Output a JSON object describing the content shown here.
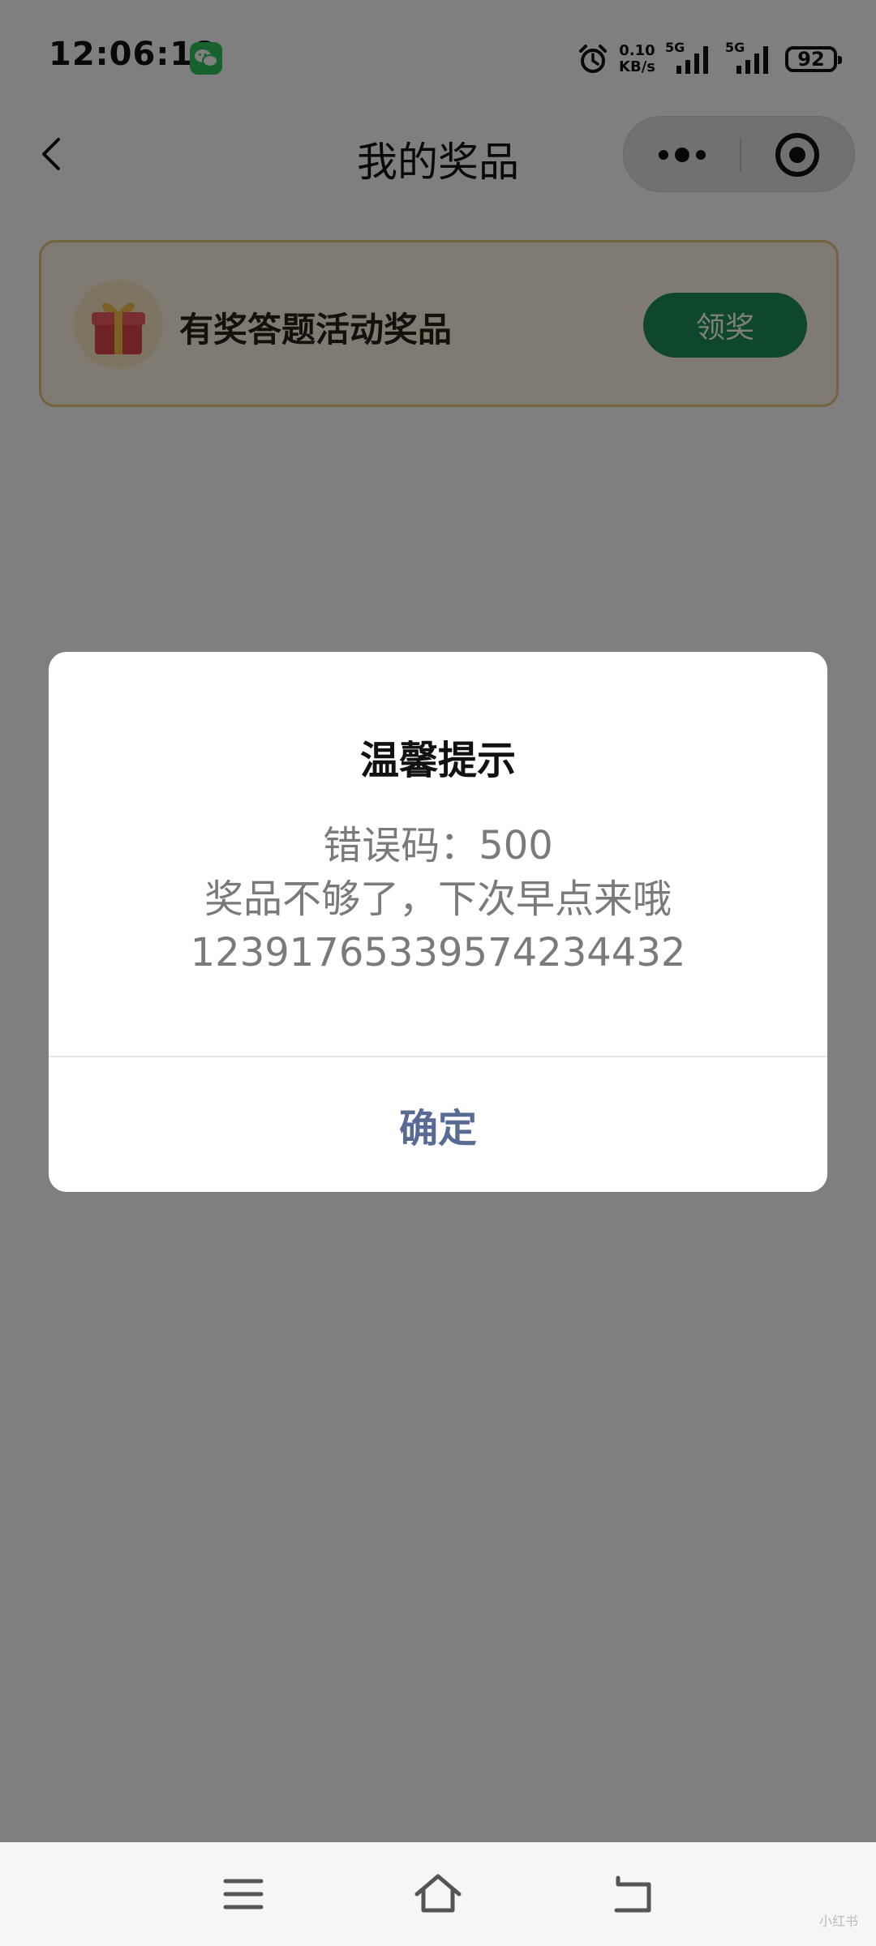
{
  "status_bar": {
    "time": "12:06:18",
    "net_speed_value": "0.10",
    "net_speed_unit": "KB/s",
    "signal1_label": "5G",
    "signal2_label": "5G",
    "battery": "92",
    "icons": [
      "wechat-icon",
      "alarm-icon",
      "signal-icon",
      "battery-icon"
    ]
  },
  "nav": {
    "title": "我的奖品",
    "icons": [
      "back-arrow-icon",
      "more-dots-icon",
      "close-target-icon"
    ]
  },
  "prize_card": {
    "name": "有奖答题活动奖品",
    "button_label": "领奖",
    "icon": "gift-icon",
    "colors": {
      "border": "#e8c77e",
      "background": "#fff6e4",
      "button": "#1f8f57"
    }
  },
  "modal": {
    "title": "温馨提示",
    "error_line": "错误码：500",
    "message": "奖品不够了，下次早点来哦",
    "code": "12391765339574234432",
    "confirm_label": "确定",
    "colors": {
      "confirm": "#576b95",
      "body_text": "#7a7a7a"
    }
  },
  "system_nav": {
    "icons": [
      "menu-icon",
      "home-icon",
      "back-icon"
    ]
  },
  "watermark": "小红书"
}
